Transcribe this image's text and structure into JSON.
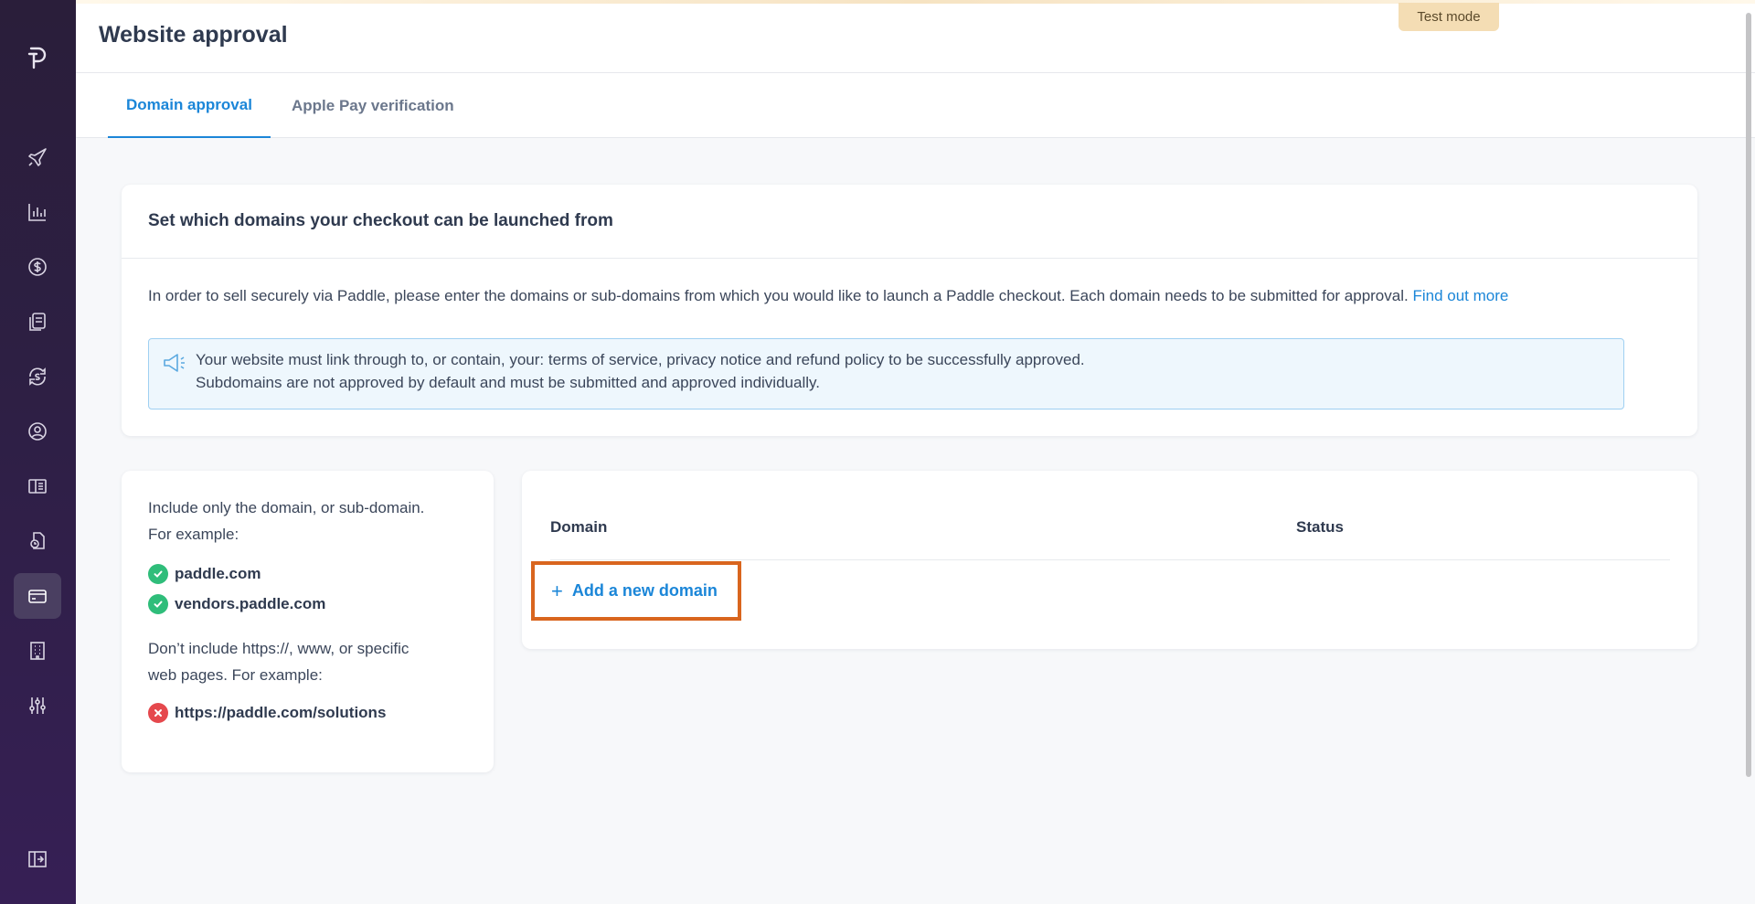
{
  "app": {
    "page_title": "Website approval",
    "test_mode_badge": "Test mode"
  },
  "sidebar": {
    "items": [
      {
        "icon": "paddle-logo-icon"
      },
      {
        "icon": "rocket-icon"
      },
      {
        "icon": "bar-chart-icon"
      },
      {
        "icon": "dollar-circle-icon"
      },
      {
        "icon": "documents-icon"
      },
      {
        "icon": "subscription-cycle-icon"
      },
      {
        "icon": "user-circle-icon"
      },
      {
        "icon": "catalog-book-icon"
      },
      {
        "icon": "checkout-settings-icon"
      },
      {
        "icon": "credit-card-icon",
        "active": true
      },
      {
        "icon": "building-icon"
      },
      {
        "icon": "sliders-icon"
      },
      {
        "icon": "collapse-sidebar-icon"
      }
    ]
  },
  "tabs": [
    {
      "label": "Domain approval",
      "active": true
    },
    {
      "label": "Apple Pay verification",
      "active": false
    }
  ],
  "intro_card": {
    "heading": "Set which domains your checkout can be launched from",
    "body": "In order to sell securely via Paddle, please enter the domains or sub-domains from which you would like to launch a Paddle checkout. Each domain needs to be submitted for approval.",
    "link": "Find out more",
    "notice_line1": "Your website must link through to, or contain, your: terms of service, privacy notice and refund policy to be successfully approved.",
    "notice_line2": "Subdomains are not approved by default and must be submitted and approved individually."
  },
  "help_card": {
    "include_line1": "Include only the domain, or sub-domain.",
    "include_line2": "For example:",
    "good_examples": [
      "paddle.com",
      "vendors.paddle.com"
    ],
    "exclude_line1": "Don’t include https://, www, or specific",
    "exclude_line2": "web pages. For example:",
    "bad_example": "https://paddle.com/solutions"
  },
  "domains_table": {
    "col_domain": "Domain",
    "col_status": "Status",
    "add_button": "Add a new domain"
  },
  "colors": {
    "accent": "#1b86d8",
    "sidebar_bg": "#2d1f43",
    "success": "#2fbd7a",
    "error": "#e5484d",
    "highlight": "#d9651e"
  }
}
